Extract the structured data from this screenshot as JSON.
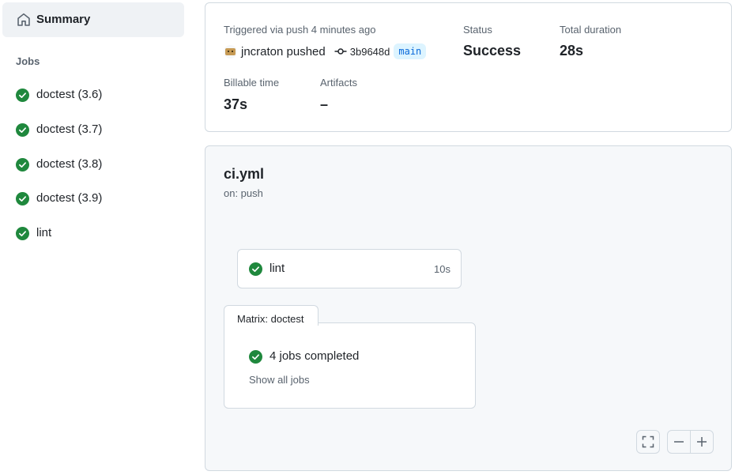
{
  "sidebar": {
    "summary_label": "Summary",
    "jobs_heading": "Jobs",
    "jobs": [
      {
        "name": "doctest (3.6)",
        "icon": "check-circle-icon"
      },
      {
        "name": "doctest (3.7)",
        "icon": "check-circle-icon"
      },
      {
        "name": "doctest (3.8)",
        "icon": "check-circle-icon"
      },
      {
        "name": "doctest (3.9)",
        "icon": "check-circle-icon"
      },
      {
        "name": "lint",
        "icon": "check-circle-icon"
      }
    ]
  },
  "summary": {
    "trigger_text": "Triggered via push 4 minutes ago",
    "pusher_text": "jncraton pushed",
    "commit_sha": "3b9648d",
    "branch": "main",
    "status_label": "Status",
    "status_value": "Success",
    "duration_label": "Total duration",
    "duration_value": "28s",
    "billable_label": "Billable time",
    "billable_value": "37s",
    "artifacts_label": "Artifacts",
    "artifacts_value": "–"
  },
  "workflow": {
    "file_name": "ci.yml",
    "trigger": "on: push",
    "job": {
      "name": "lint",
      "duration": "10s"
    },
    "matrix": {
      "tab_label": "Matrix: doctest",
      "completed_text": "4 jobs completed",
      "show_all_label": "Show all jobs"
    }
  },
  "colors": {
    "success": "#1f883d",
    "link_blue": "#0969da",
    "border": "#d1d9e0",
    "muted": "#59636e"
  }
}
